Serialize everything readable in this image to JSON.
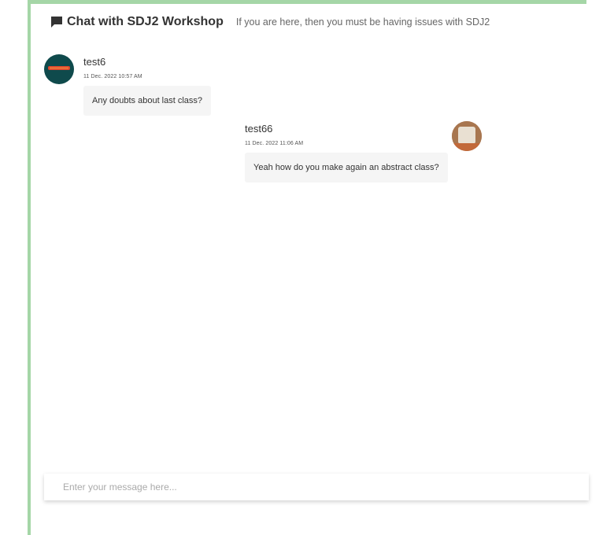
{
  "header": {
    "icon": "chat-bubble-icon",
    "title": "Chat with SDJ2 Workshop",
    "subtitle": "If you are here, then you must be having issues with SDJ2"
  },
  "messages": [
    {
      "author": "test6",
      "timestamp": "11 Dec. 2022 10:57 AM",
      "text": "Any doubts about last class?",
      "avatar_color": "#0f4a4c"
    },
    {
      "author": "test66",
      "timestamp": "11 Dec. 2022 11:06 AM",
      "text": "Yeah how do you make again an abstract class?",
      "avatar_color": "#b98560"
    }
  ],
  "composer": {
    "placeholder": "Enter your message here..."
  },
  "colors": {
    "accent_border": "#a5d6a7",
    "bubble_bg": "#f5f5f5"
  }
}
